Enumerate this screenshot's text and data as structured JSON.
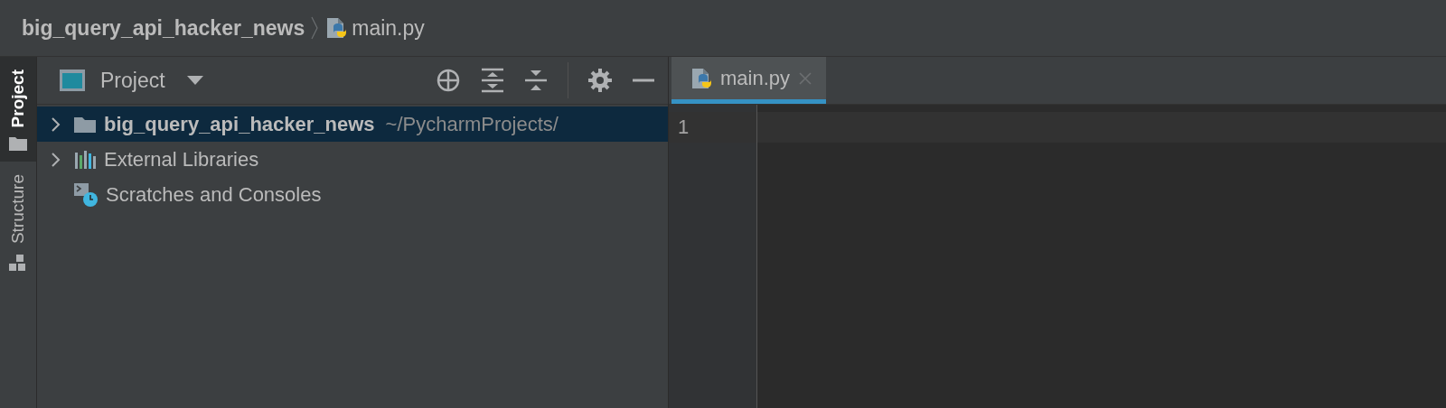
{
  "breadcrumb": [
    {
      "label": "big_query_api_hacker_news",
      "kind": "project"
    },
    {
      "label": "main.py",
      "kind": "python"
    }
  ],
  "tool_strip": [
    {
      "label": "Project",
      "kind": "folder",
      "selected": true
    },
    {
      "label": "Structure",
      "kind": "structure",
      "selected": false
    }
  ],
  "project_panel": {
    "title": "Project",
    "tree": [
      {
        "label": "big_query_api_hacker_news",
        "path": "~/PycharmProjects/",
        "kind": "folder",
        "expanded": false,
        "selected": true
      },
      {
        "label": "External Libraries",
        "kind": "library",
        "expanded": false,
        "selected": false
      },
      {
        "label": "Scratches and Consoles",
        "kind": "scratches",
        "selected": false
      }
    ]
  },
  "editor": {
    "tabs": [
      {
        "label": "main.py",
        "selected": true
      }
    ],
    "line_numbers": [
      "1"
    ]
  }
}
